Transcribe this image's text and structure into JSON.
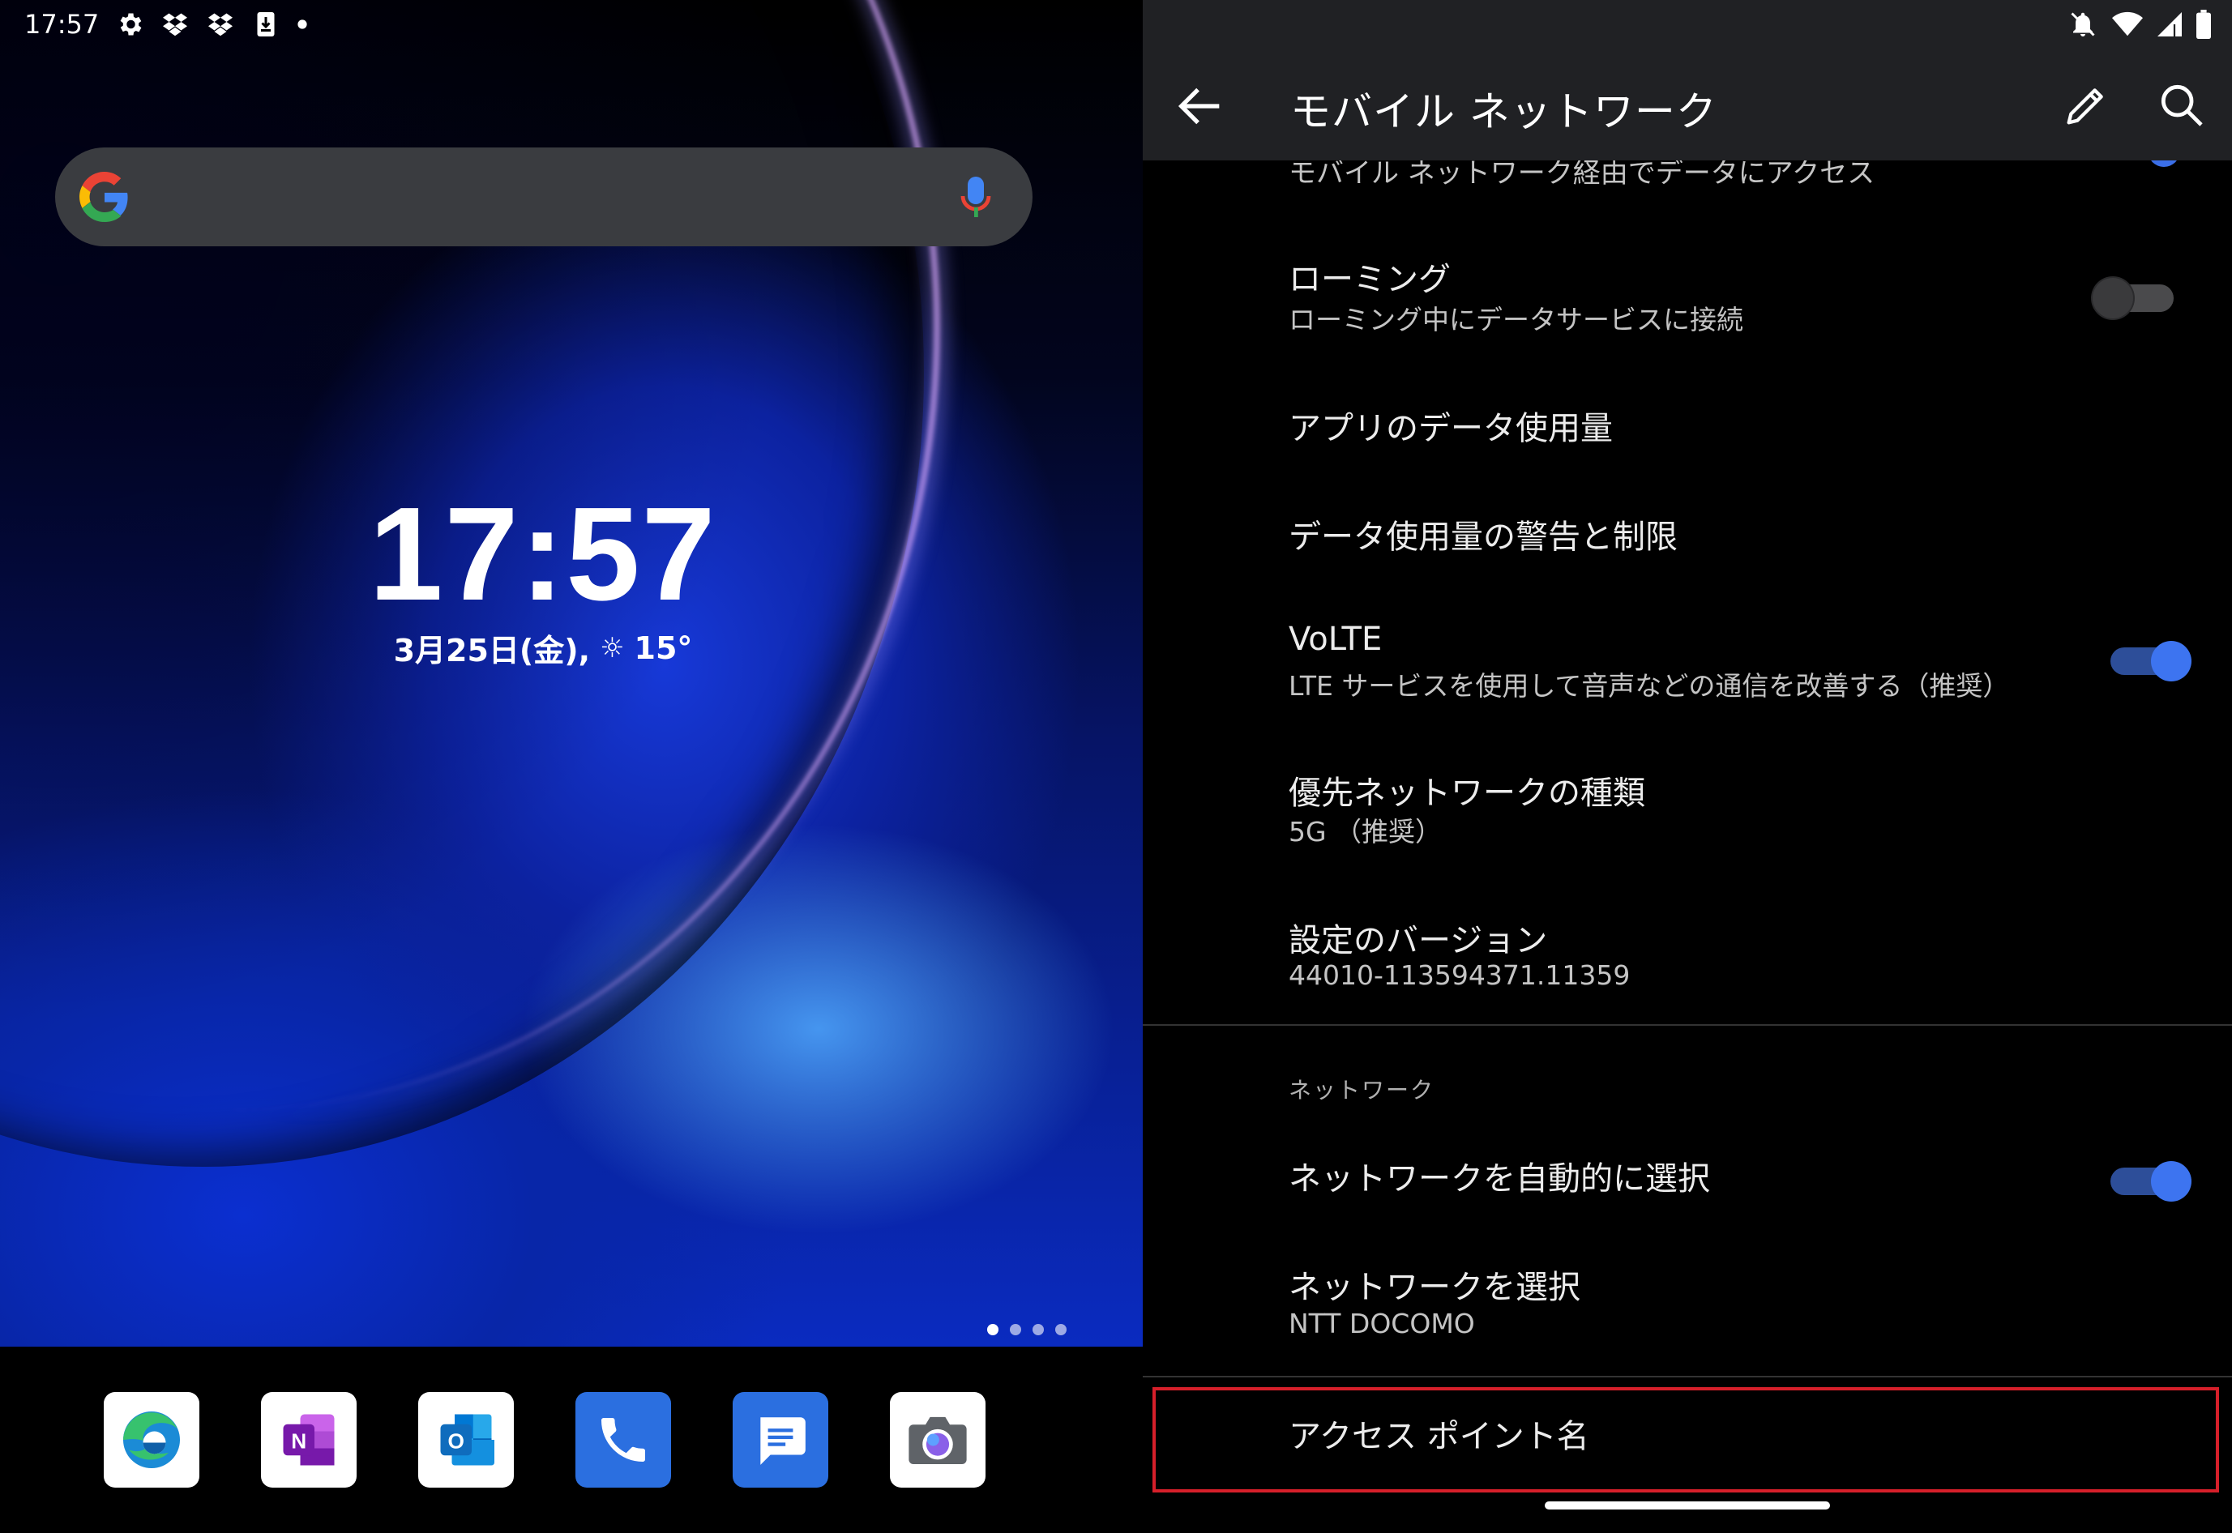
{
  "home_screen": {
    "status_time": "17:57",
    "clock": "17:57",
    "date": "3月25日(金),",
    "weather_temp": "15°",
    "dock_apps": [
      "edge-icon",
      "onenote-icon",
      "outlook-icon",
      "phone-icon",
      "messages-icon",
      "camera-icon"
    ]
  },
  "settings": {
    "title": "モバイル ネットワーク",
    "partial_item": "モバイル ネットワーク経由でデータにアクセス",
    "items": [
      {
        "title": "ローミング",
        "subtitle": "ローミング中にデータサービスに接続",
        "toggle": "off"
      },
      {
        "title": "アプリのデータ使用量"
      },
      {
        "title": "データ使用量の警告と制限"
      },
      {
        "title": "VoLTE",
        "subtitle": "LTE サービスを使用して音声などの通信を改善する（推奨）",
        "toggle": "on"
      },
      {
        "title": "優先ネットワークの種類",
        "subtitle": "5G （推奨）"
      },
      {
        "title": "設定のバージョン",
        "subtitle": "44010-113594371.11359"
      },
      {
        "title": "ネットワークを自動的に選択",
        "toggle": "on"
      },
      {
        "title": "ネットワークを選択",
        "subtitle": "NTT DOCOMO"
      },
      {
        "title": "アクセス ポイント名"
      }
    ],
    "section_network": "ネットワーク",
    "highlight_color": "#d61f2a",
    "accent": "#3d74f0"
  }
}
